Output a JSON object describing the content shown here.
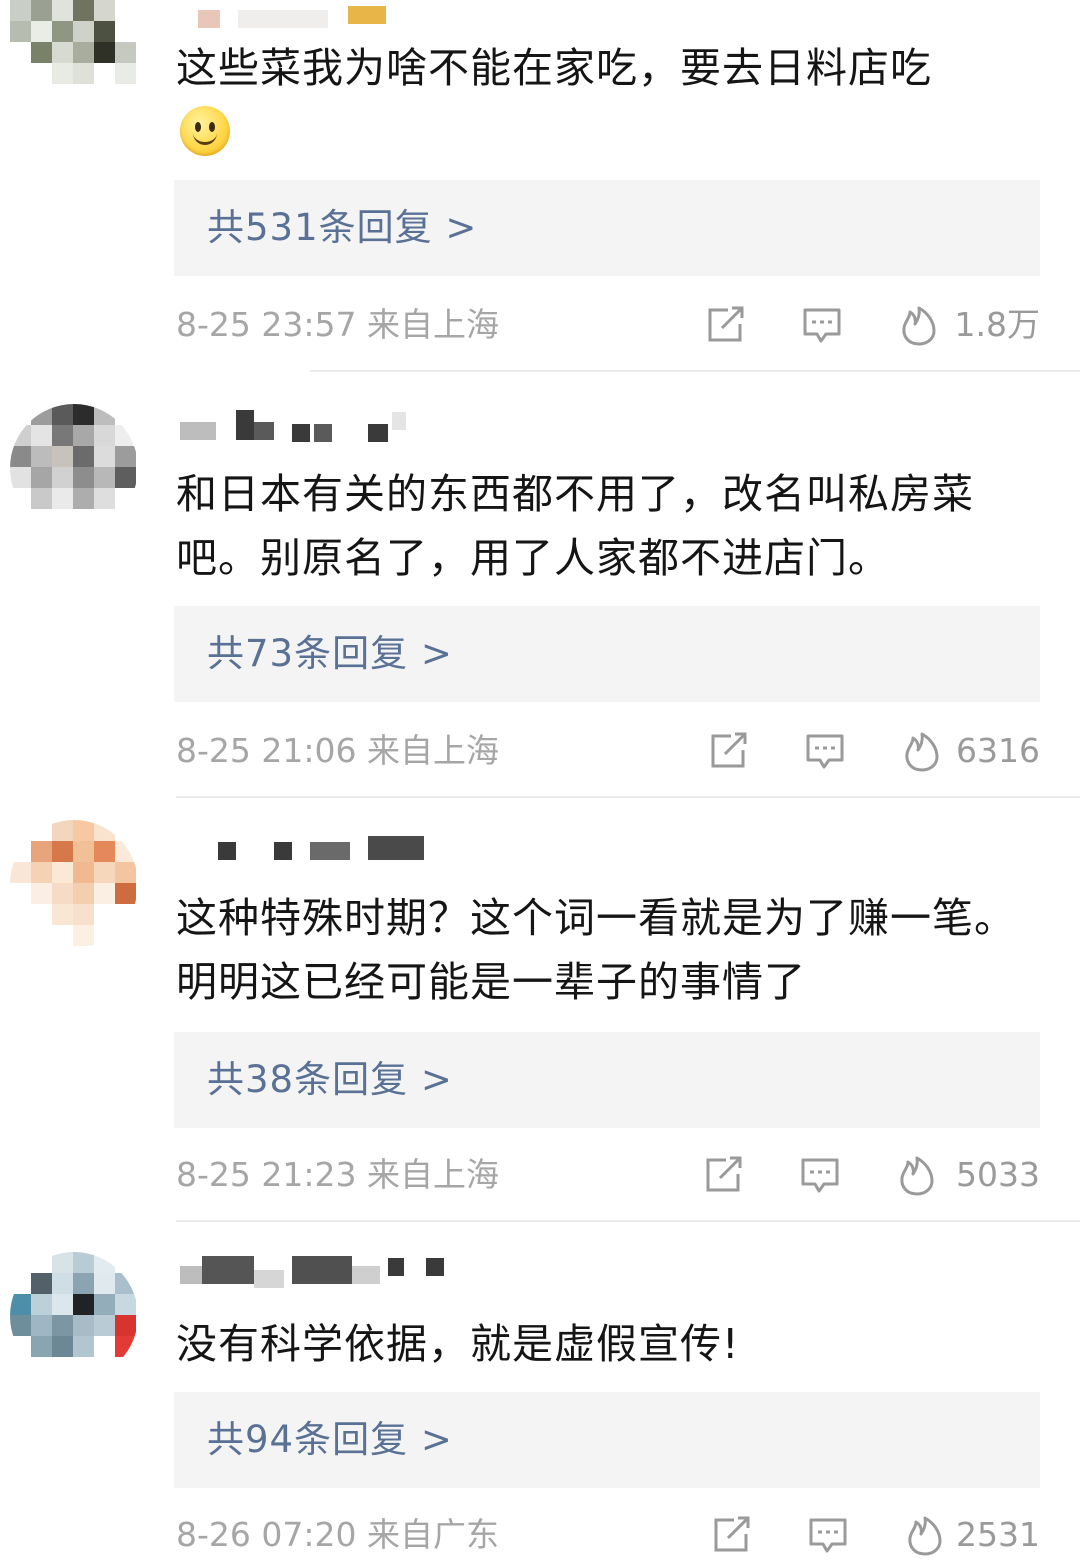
{
  "comments": [
    {
      "text": "这些菜我为啥不能在家吃，要去日料店吃",
      "emoji": "smiley-emoji",
      "replies": "共531条回复 >",
      "time": "8-25 23:57 来自上海",
      "likes": "1.8万"
    },
    {
      "text": "和日本有关的东西都不用了，改名叫私房菜吧。别原名了，用了人家都不进店门。",
      "replies": "共73条回复 >",
      "time": "8-25 21:06 来自上海",
      "likes": "6316"
    },
    {
      "text": "这种特殊时期？这个词一看就是为了赚一笔。明明这已经可能是一辈子的事情了",
      "replies": "共38条回复 >",
      "time": "8-25 21:23 来自上海",
      "likes": "5033"
    },
    {
      "text": "没有科学依据，就是虚假宣传!",
      "replies": "共94条回复 >",
      "time": "8-26 07:20 来自广东",
      "likes": "2531"
    }
  ],
  "icons": {
    "share": "share-icon",
    "comment": "comment-icon",
    "like": "flame-icon"
  },
  "colors": {
    "reply_link": "#5a7196",
    "meta_text": "#a6a6a6",
    "reply_bg": "#f4f4f4"
  }
}
